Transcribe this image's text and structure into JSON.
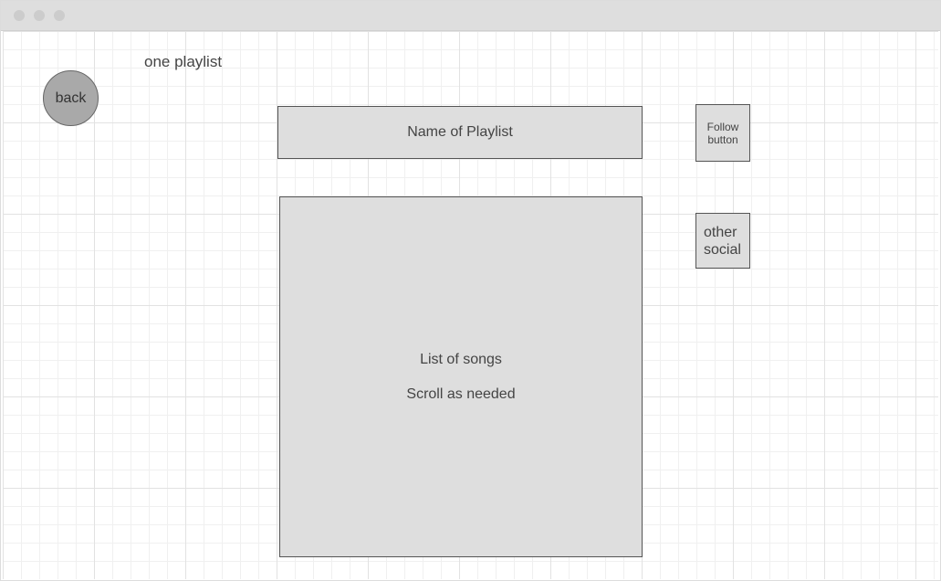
{
  "header": {
    "title": "one playlist"
  },
  "nav": {
    "back_label": "back"
  },
  "playlist": {
    "name": "Name of Playlist",
    "songs_line1": "List of songs",
    "songs_line2": "Scroll as needed"
  },
  "actions": {
    "follow_label": "Follow button",
    "social_label": "other social"
  },
  "colors": {
    "box_fill": "#dedede",
    "back_fill": "#a9a9a9",
    "titlebar": "#dedede"
  }
}
